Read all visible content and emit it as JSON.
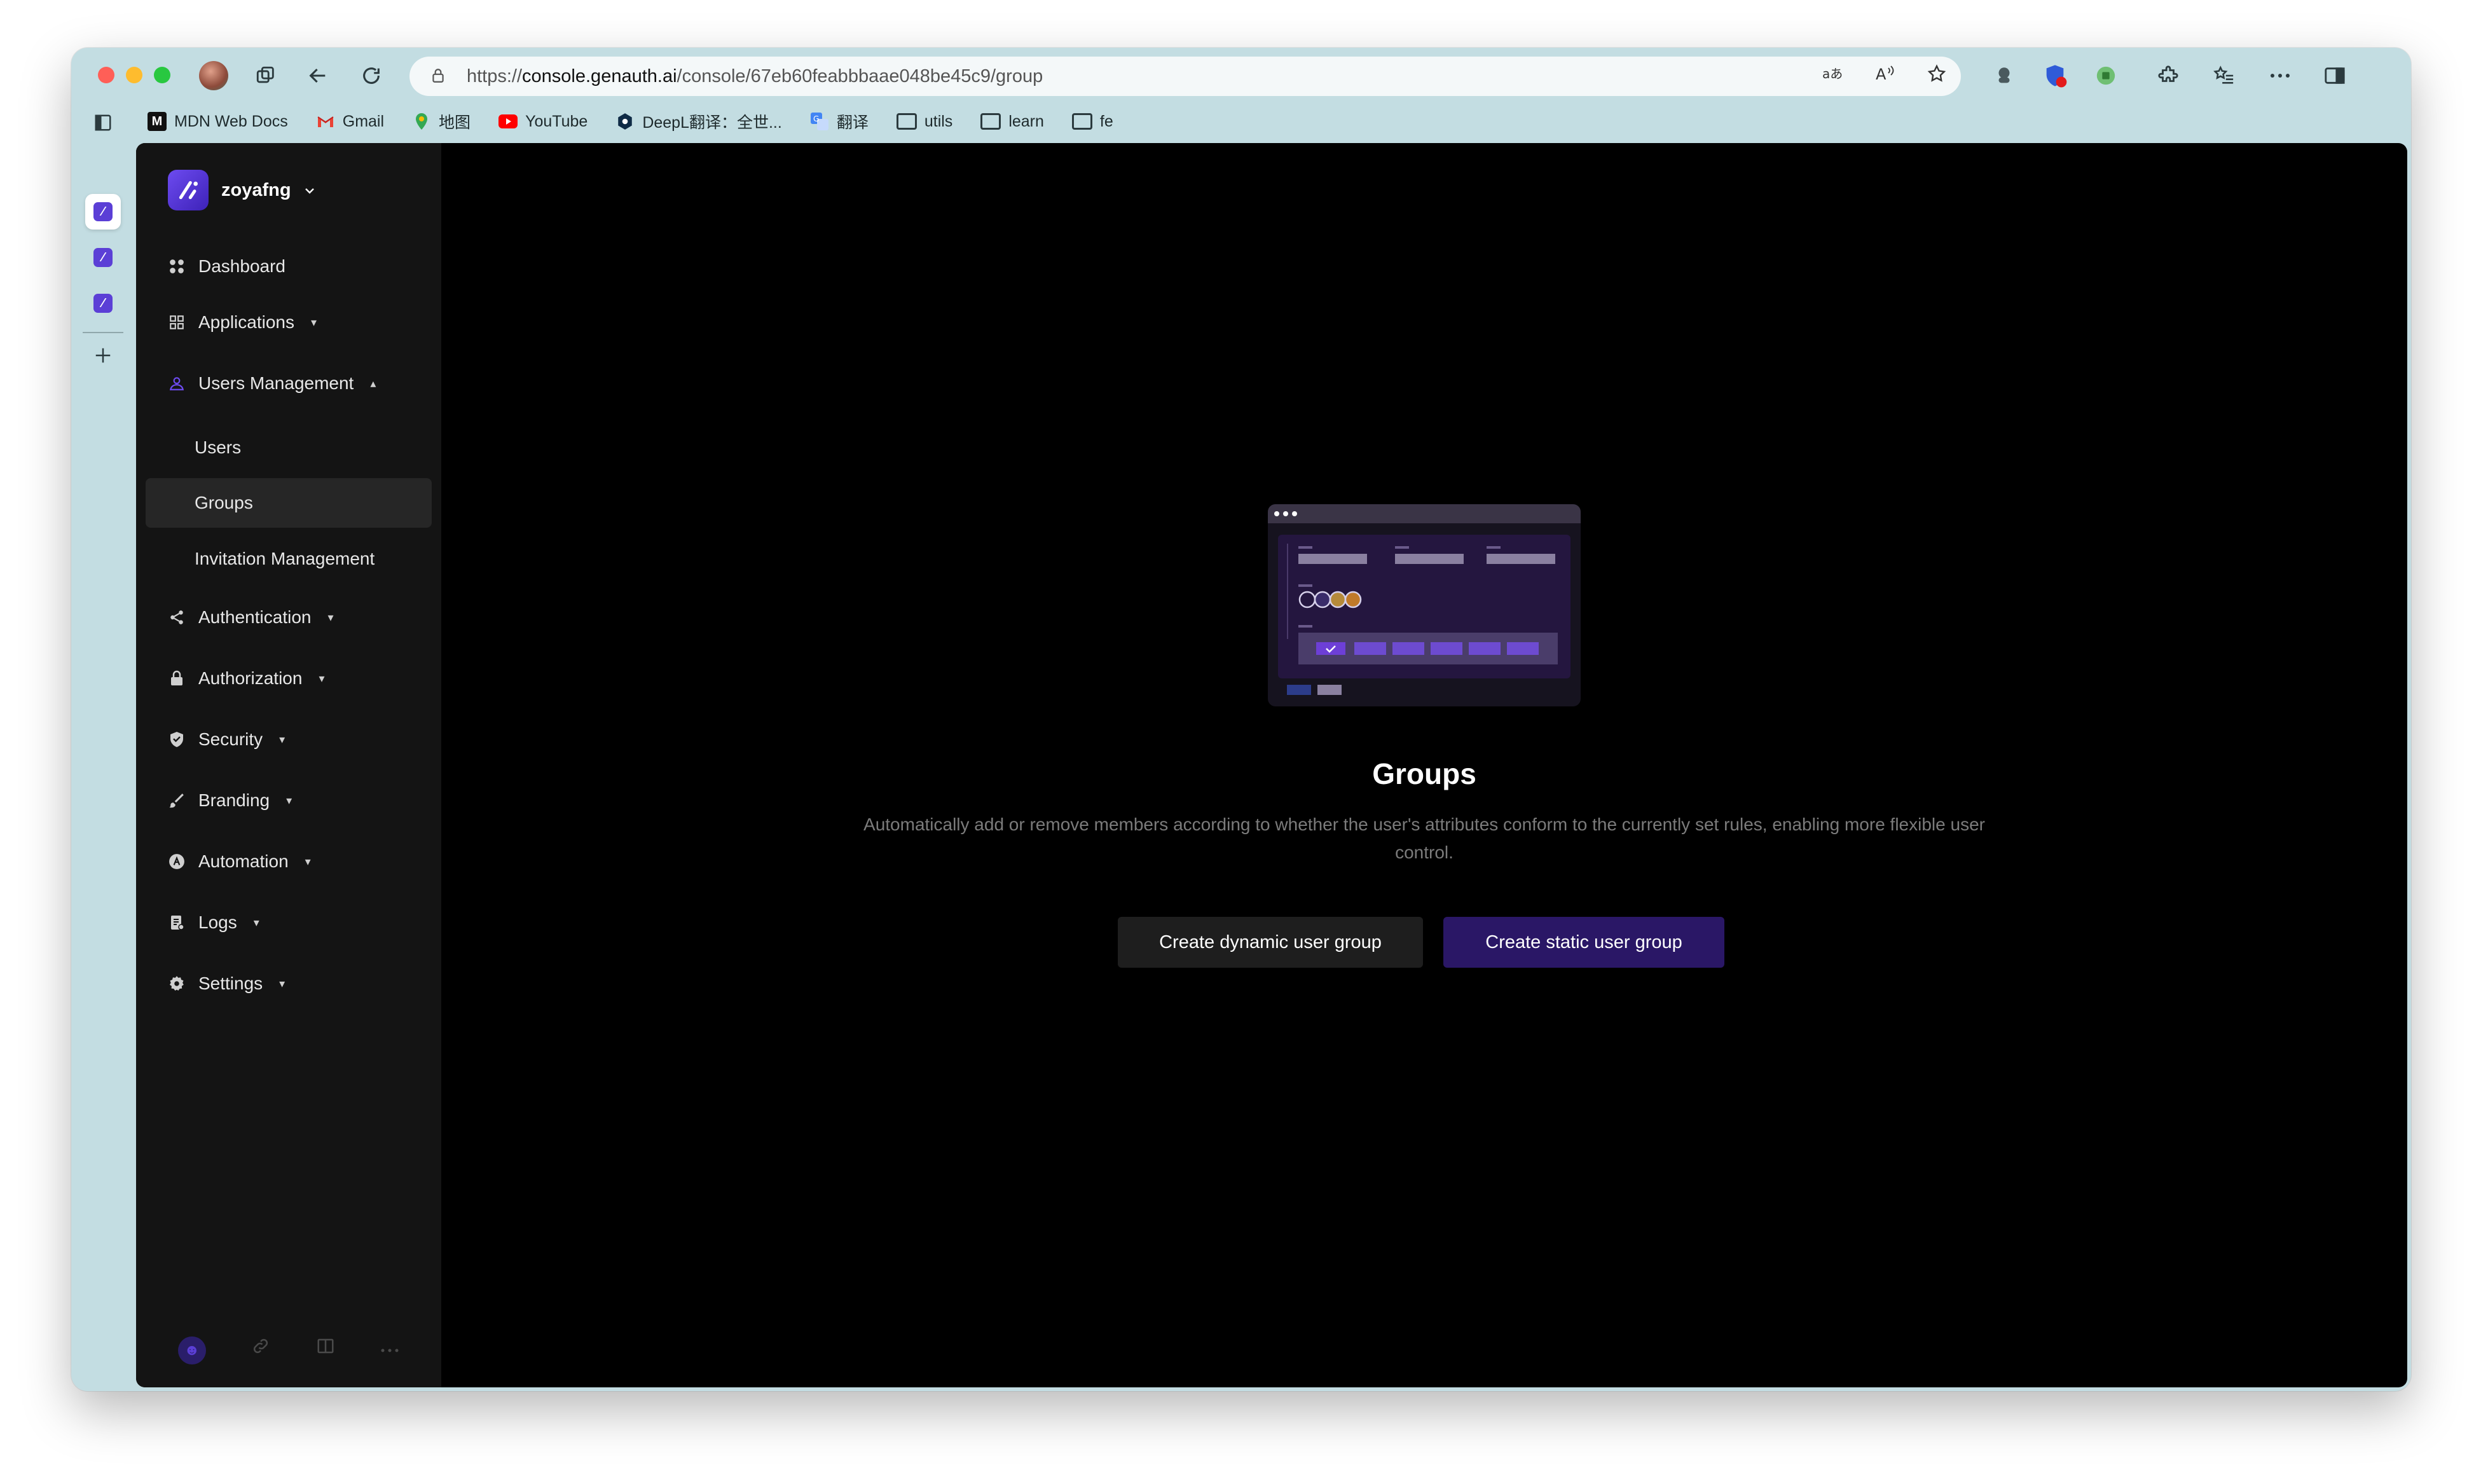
{
  "browser": {
    "url_prefix": "https://",
    "url_host": "console.genauth.ai",
    "url_path": "/console/67eb60feabbbaae048be45c9/group",
    "bookmarks": [
      {
        "label": "MDN Web Docs",
        "icon": "mdn-icon"
      },
      {
        "label": "Gmail",
        "icon": "gmail-icon"
      },
      {
        "label": "地图",
        "icon": "maps-icon"
      },
      {
        "label": "YouTube",
        "icon": "youtube-icon"
      },
      {
        "label": "DeepL翻译：全世...",
        "icon": "deepl-icon"
      },
      {
        "label": "翻译",
        "icon": "translate-icon"
      },
      {
        "label": "utils",
        "icon": "folder-icon"
      },
      {
        "label": "learn",
        "icon": "folder-icon"
      },
      {
        "label": "fe",
        "icon": "folder-icon"
      }
    ]
  },
  "sidebar": {
    "org_name": "zoyafng",
    "items": {
      "dashboard": "Dashboard",
      "applications": "Applications",
      "users_management": "Users Management",
      "users": "Users",
      "groups": "Groups",
      "invitation_management": "Invitation Management",
      "authentication": "Authentication",
      "authorization": "Authorization",
      "security": "Security",
      "branding": "Branding",
      "automation": "Automation",
      "logs": "Logs",
      "settings": "Settings"
    }
  },
  "main": {
    "title": "Groups",
    "description": "Automatically add or remove members according to whether the user's attributes conform to the currently set rules, enabling more flexible user control.",
    "create_dynamic_label": "Create dynamic user group",
    "create_static_label": "Create static user group"
  },
  "colors": {
    "accent": "#6d4bf0",
    "static_button": "#2a1766",
    "dynamic_button": "#1e1e1e",
    "sidebar_bg": "#141414"
  }
}
